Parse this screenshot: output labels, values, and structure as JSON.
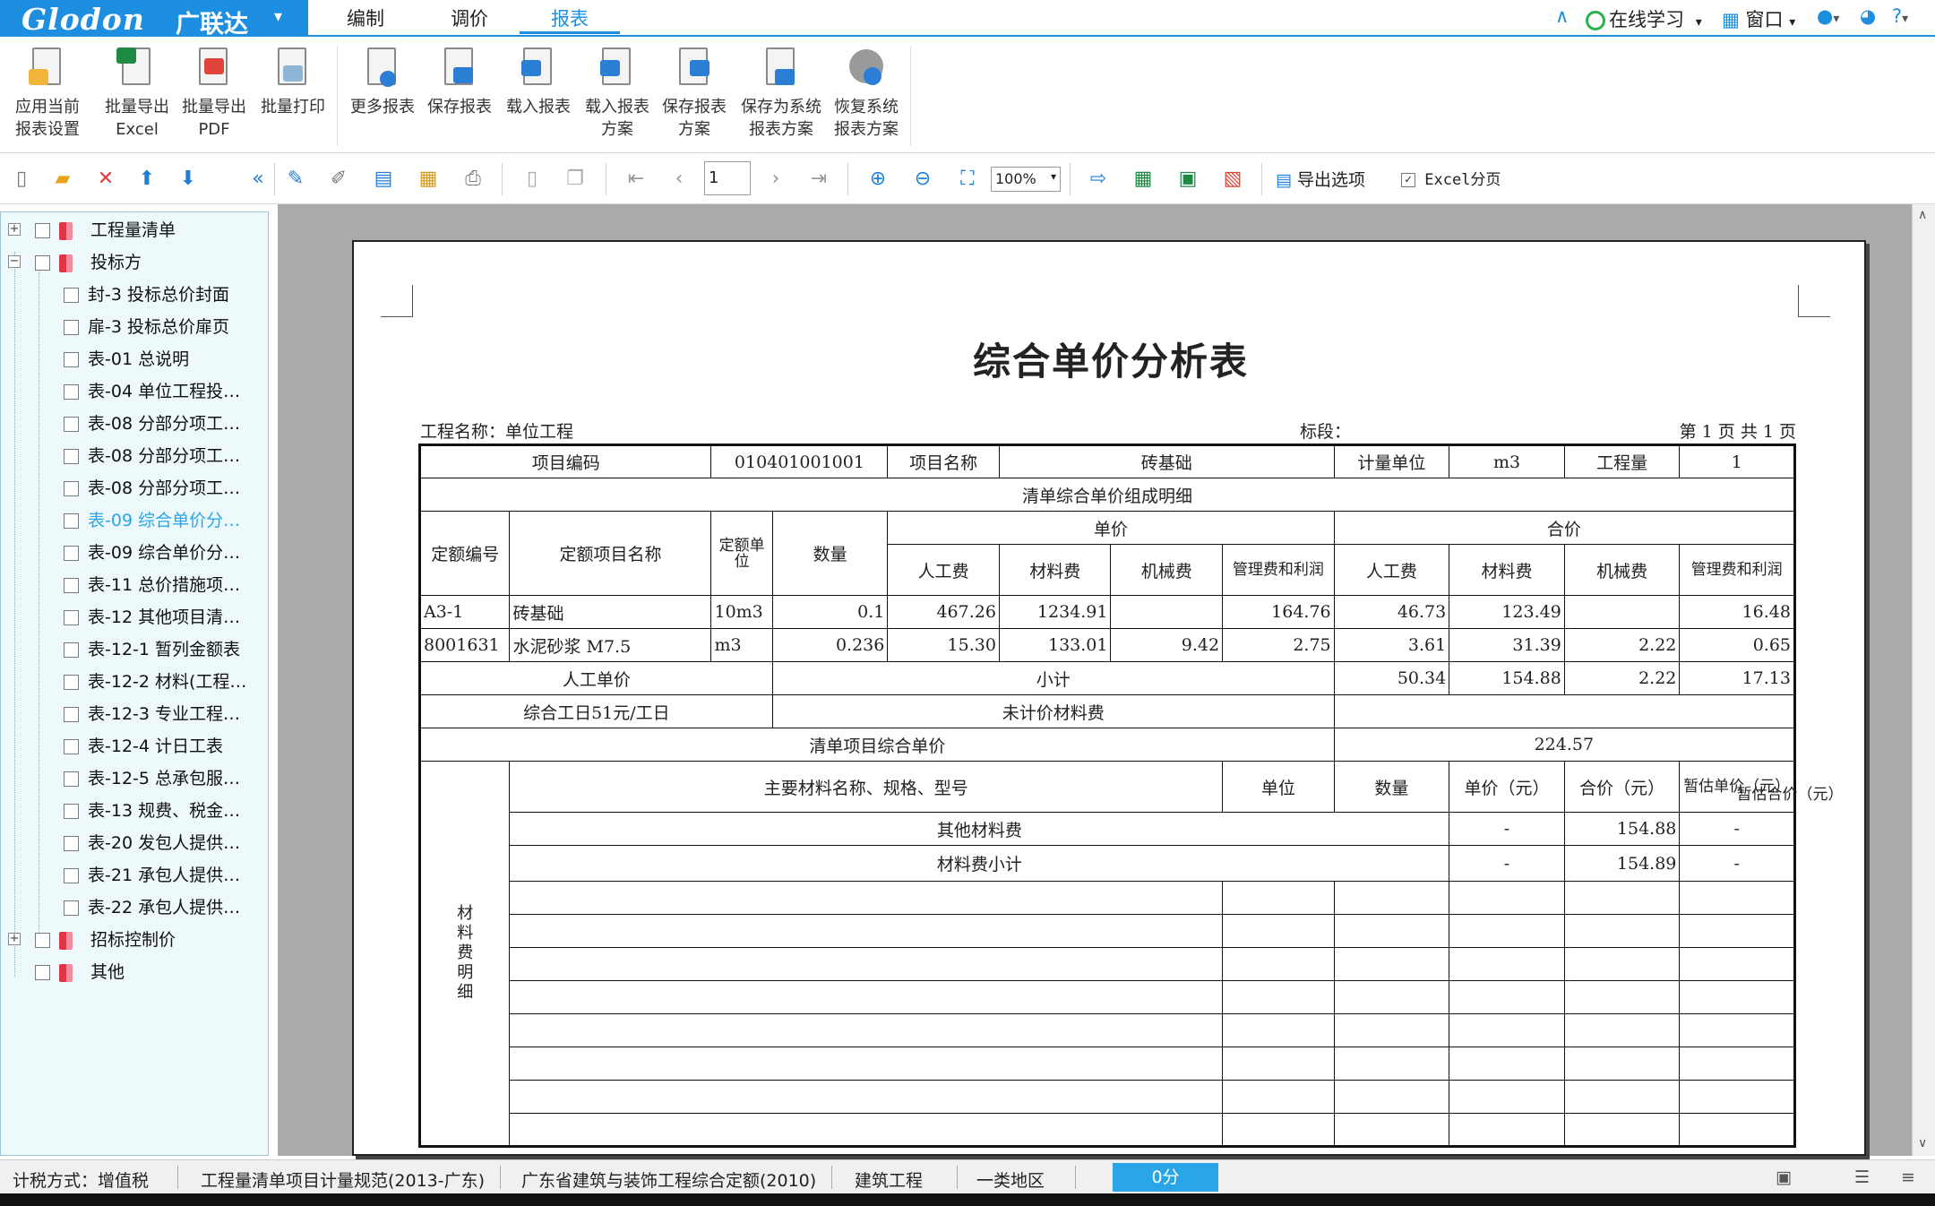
{
  "app": {
    "brand": "Glodon",
    "brand_cn": "广联达",
    "menu_tabs": [
      "编制",
      "调价",
      "报表"
    ],
    "active_tab": "报表",
    "online_learning": "在线学习",
    "window_menu": "窗口",
    "help": "?"
  },
  "ribbon": {
    "buttons": [
      {
        "line1": "应用当前",
        "line2": "报表设置",
        "icon": "apply-settings-icon"
      },
      {
        "line1": "批量导出",
        "line2": "Excel",
        "icon": "excel-export-icon"
      },
      {
        "line1": "批量导出",
        "line2": "PDF",
        "icon": "pdf-export-icon"
      },
      {
        "line1": "批量打印",
        "line2": "",
        "icon": "batch-print-icon"
      },
      {
        "line1": "更多报表",
        "line2": "",
        "icon": "more-reports-icon"
      },
      {
        "line1": "保存报表",
        "line2": "",
        "icon": "save-report-icon"
      },
      {
        "line1": "载入报表",
        "line2": "",
        "icon": "load-report-icon"
      },
      {
        "line1": "载入报表",
        "line2": "方案",
        "icon": "load-scheme-icon"
      },
      {
        "line1": "保存报表",
        "line2": "方案",
        "icon": "save-scheme-icon"
      },
      {
        "line1": "保存为系统",
        "line2": "报表方案",
        "icon": "save-system-scheme-icon"
      },
      {
        "line1": "恢复系统",
        "line2": "报表方案",
        "icon": "restore-scheme-icon"
      }
    ]
  },
  "toolbar2": {
    "page_value": "1",
    "zoom_value": "100%",
    "export_options": "导出选项",
    "excel_paging": "Excel分页"
  },
  "tree": {
    "groups": [
      {
        "label": "工程量清单",
        "expanded": false
      },
      {
        "label": "投标方",
        "expanded": true
      }
    ],
    "children": [
      "封-3 投标总价封面",
      "扉-3 投标总价扉页",
      "表-01 总说明",
      "表-04 单位工程投…",
      "表-08 分部分项工…",
      "表-08 分部分项工…",
      "表-08 分部分项工…",
      "表-09 综合单价分…",
      "表-09 综合单价分…",
      "表-11 总价措施项…",
      "表-12 其他项目清…",
      "表-12-1 暂列金额表",
      "表-12-2 材料(工程…",
      "表-12-3 专业工程…",
      "表-12-4 计日工表",
      "表-12-5 总承包服…",
      "表-13 规费、税金…",
      "表-20 发包人提供…",
      "表-21 承包人提供…",
      "表-22 承包人提供…"
    ],
    "selected_index": 7,
    "tail_groups": [
      {
        "label": "招标控制价",
        "expanded": false
      },
      {
        "label": "其他",
        "expanded": false
      }
    ]
  },
  "report": {
    "title": "综合单价分析表",
    "project_name": "工程名称：单位工程",
    "section": "标段：",
    "page_info": "第 1 页  共 1 页",
    "h_item_code": "项目编码",
    "item_code": "010401001001",
    "h_item_name": "项目名称",
    "item_name": "砖基础",
    "h_unit": "计量单位",
    "unit": "m3",
    "h_qty": "工程量",
    "qty": "1",
    "composition_title": "清单综合单价组成明细",
    "h_quota_code": "定额编号",
    "h_quota_name": "定额项目名称",
    "h_quota_unit": "定额单位",
    "h_amount": "数量",
    "h_unit_price": "单价",
    "h_total_price": "合价",
    "h_labor": "人工费",
    "h_material": "材料费",
    "h_machine": "机械费",
    "h_mgmt": "管理费和利润",
    "rows": [
      {
        "code": "A3-1",
        "name": "砖基础",
        "unit": "10m3",
        "qty": "0.1",
        "u_labor": "467.26",
        "u_mat": "1234.91",
        "u_mach": "",
        "u_mgmt": "164.76",
        "t_labor": "46.73",
        "t_mat": "123.49",
        "t_mach": "",
        "t_mgmt": "16.48"
      },
      {
        "code": "8001631",
        "name": "水泥砂浆 M7.5",
        "unit": "m3",
        "qty": "0.236",
        "u_labor": "15.30",
        "u_mat": "133.01",
        "u_mach": "9.42",
        "u_mgmt": "2.75",
        "t_labor": "3.61",
        "t_mat": "31.39",
        "t_mach": "2.22",
        "t_mgmt": "0.65"
      }
    ],
    "labor_unit_price": "人工单价",
    "subtotal": "小计",
    "sub_labor": "50.34",
    "sub_mat": "154.88",
    "sub_mach": "2.22",
    "sub_mgmt": "17.13",
    "labor_day": "综合工日51元/工日",
    "unpriced_material": "未计价材料费",
    "composite_label": "清单项目综合单价",
    "composite_value": "224.57",
    "mat_detail_label": "材料费明细",
    "h_main_mat": "主要材料名称、规格、型号",
    "h_m_unit": "单位",
    "h_m_qty": "数量",
    "h_m_uprice": "单价（元）",
    "h_m_total": "合价（元）",
    "h_m_est_u": "暂估单价（元）",
    "h_m_est_t": "暂估合价（元）",
    "other_mat": "其他材料费",
    "other_mat_dash1": "-",
    "other_mat_value": "154.88",
    "other_mat_dash2": "-",
    "mat_subtotal": "材料费小计",
    "mat_sub_dash1": "-",
    "mat_sub_value": "154.89",
    "mat_sub_dash2": "-"
  },
  "status": {
    "tax_mode": "计税方式：增值税",
    "spec": "工程量清单项目计量规范(2013-广东)",
    "quota": "广东省建筑与装饰工程综合定额(2010)",
    "discipline": "建筑工程",
    "region": "一类地区",
    "score": "0分"
  },
  "colors": {
    "brand_blue": "#1e8fe0",
    "tree_bg": "#eef9fc",
    "selected_text": "#2aa6e8",
    "preview_bg": "#aaaaaa"
  }
}
